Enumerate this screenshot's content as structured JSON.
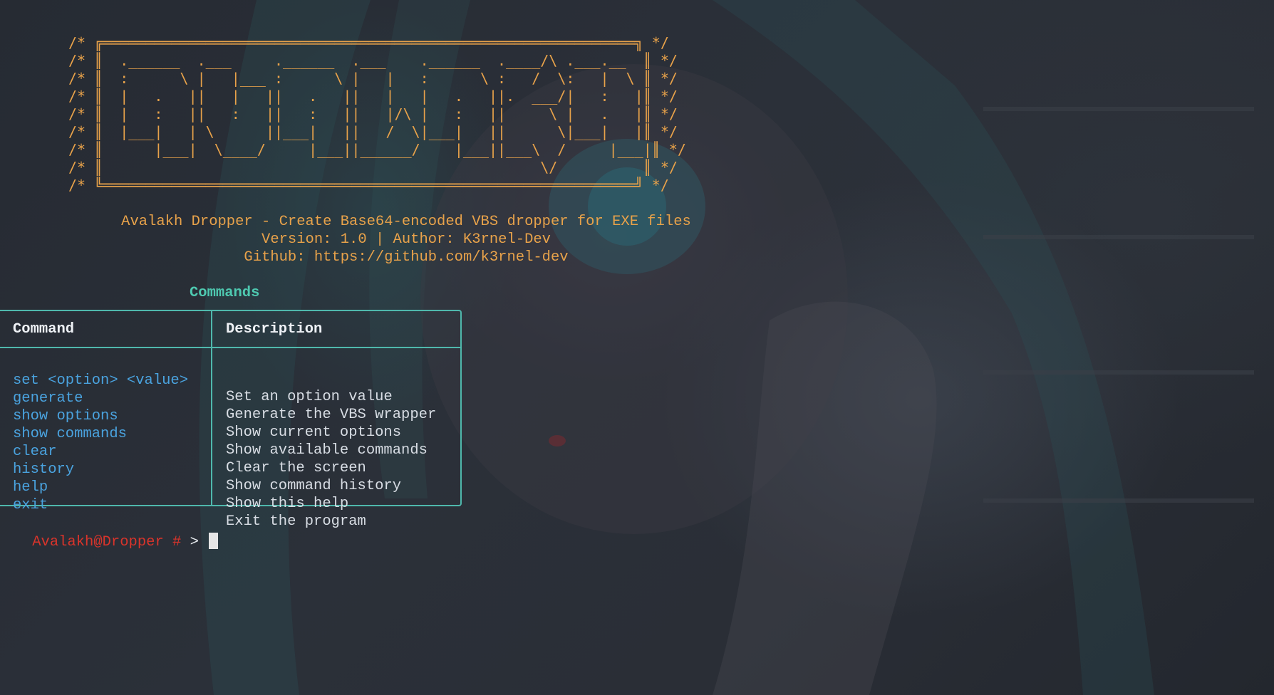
{
  "banner": {
    "lines": [
      "/* ╔══════════════════════════════════════════════════════════════╗ */",
      "/* ║  .______  .___     .______  .___    .______  .____/\\ .___.__  ║ */",
      "/* ║  :      \\ |   |___ :      \\ |   |   :      \\ :   /  \\:   |  \\ ║ */",
      "/* ║  |   .   ||   |   ||   .   ||   |   |   .   ||.  ___/|   :   |║ */",
      "/* ║  |   :   ||   :   ||   :   ||   |/\\ |   :   ||     \\ |   .   |║ */",
      "/* ║  |___|   | \\      ||___|   ||   /  \\|___|   ||      \\|___|   |║ */",
      "/* ║      |___|  \\____/     |___||______/    |___||___\\  /     |___|║ */",
      "/* ║                                                   \\/          ║ */",
      "/* ╚══════════════════════════════════════════════════════════════╝ */"
    ]
  },
  "info": {
    "description": "Avalakh Dropper - Create Base64-encoded VBS dropper for EXE files",
    "version_line": "Version: 1.0 | Author: K3rnel-Dev",
    "github_line": "Github: https://github.com/k3rnel-dev"
  },
  "commands": {
    "title": "Commands",
    "headers": [
      "Command",
      "Description"
    ],
    "rows": [
      {
        "command": "set <option> <value>",
        "description": "Set an option value"
      },
      {
        "command": "generate",
        "description": "Generate the VBS wrapper"
      },
      {
        "command": "show options",
        "description": "Show current options"
      },
      {
        "command": "show commands",
        "description": "Show available commands"
      },
      {
        "command": "clear",
        "description": "Clear the screen"
      },
      {
        "command": "history",
        "description": "Show command history"
      },
      {
        "command": "help",
        "description": "Show this help"
      },
      {
        "command": "exit",
        "description": "Exit the program"
      }
    ]
  },
  "prompt": {
    "user": "Avalakh@Dropper #",
    "symbol": ">",
    "input_value": ""
  },
  "colors": {
    "banner": "#e8a24a",
    "title": "#4ec9b0",
    "command": "#4aa3df",
    "prompt": "#d9342b",
    "border": "#4fb8ac"
  }
}
